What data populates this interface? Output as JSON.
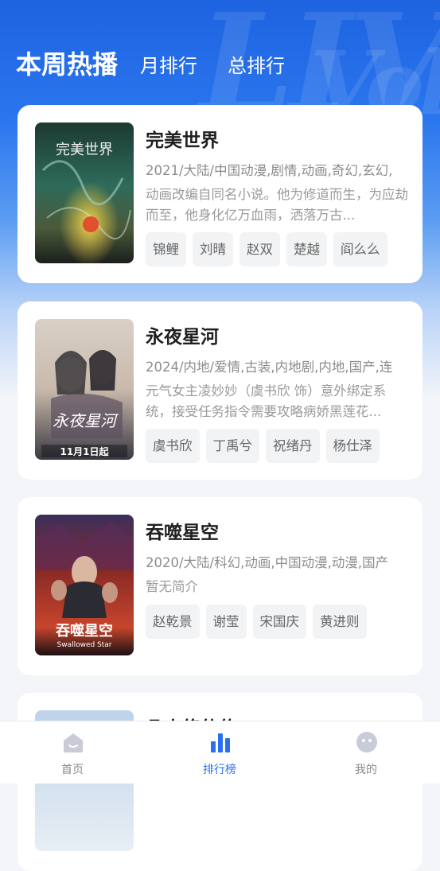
{
  "tabs": [
    {
      "label": "本周热播",
      "active": true
    },
    {
      "label": "月排行",
      "active": false
    },
    {
      "label": "总排行",
      "active": false
    }
  ],
  "items": [
    {
      "title": "完美世界",
      "meta": "2021/大陆/中国动漫,剧情,动画,奇幻,玄幻,",
      "desc": "动画改编自同名小说。他为修道而生，为应劫而至，他身化亿万血雨，洒落万古...",
      "cast": [
        "锦鲤",
        "刘晴",
        "赵双",
        "楚越",
        "阎么么"
      ],
      "poster": {
        "name": "poster-perfect-world",
        "accent": "#2f6b5a",
        "text": "完美世界"
      }
    },
    {
      "title": "永夜星河",
      "meta": "2024/内地/爱情,古装,内地剧,内地,国产,连",
      "desc": "元气女主凌妙妙（虞书欣 饰）意外绑定系统，接受任务指令需要攻略病娇黑莲花...",
      "cast": [
        "虞书欣",
        "丁禹兮",
        "祝绪丹",
        "杨仕泽"
      ],
      "poster": {
        "name": "poster-eternal-night",
        "accent": "#c9b9ab",
        "text": "永夜星河",
        "banner": "11月1日起"
      }
    },
    {
      "title": "吞噬星空",
      "meta": "2020/大陆/科幻,动画,中国动漫,动漫,国产",
      "desc": "暂无简介",
      "cast": [
        "赵乾景",
        "谢莹",
        "宋国庆",
        "黄进则"
      ],
      "poster": {
        "name": "poster-swallowed-star",
        "accent": "#8a2a25",
        "text": "吞噬星空",
        "subtitle": "Swallowed Star"
      }
    },
    {
      "title": "凡人修仙传",
      "partial": true
    }
  ],
  "bottom_nav": [
    {
      "label": "首页",
      "icon": "home-icon",
      "active": false
    },
    {
      "label": "排行榜",
      "icon": "ranking-icon",
      "active": true
    },
    {
      "label": "我的",
      "icon": "profile-icon",
      "active": false
    }
  ],
  "colors": {
    "primary": "#2a6ff0",
    "header_top": "#1e63e0"
  }
}
